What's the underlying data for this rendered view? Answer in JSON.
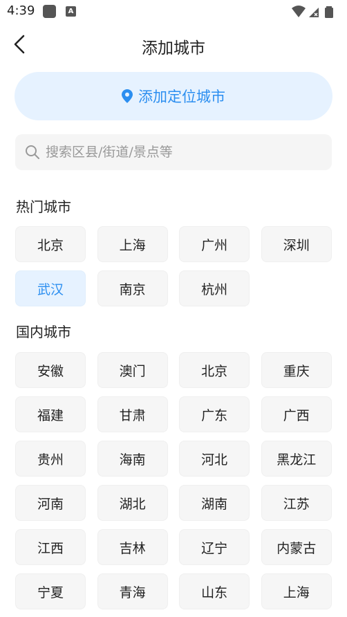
{
  "status": {
    "time": "4:39"
  },
  "header": {
    "title": "添加城市"
  },
  "locate": {
    "label": "添加定位城市"
  },
  "search": {
    "placeholder": "搜索区县/街道/景点等"
  },
  "hot": {
    "title": "热门城市",
    "cities": [
      "北京",
      "上海",
      "广州",
      "深圳",
      "武汉",
      "南京",
      "杭州"
    ],
    "selected": "武汉"
  },
  "domestic": {
    "title": "国内城市",
    "cities": [
      "安徽",
      "澳门",
      "北京",
      "重庆",
      "福建",
      "甘肃",
      "广东",
      "广西",
      "贵州",
      "海南",
      "河北",
      "黑龙江",
      "河南",
      "湖北",
      "湖南",
      "江苏",
      "江西",
      "吉林",
      "辽宁",
      "内蒙古",
      "宁夏",
      "青海",
      "山东",
      "上海"
    ]
  },
  "colors": {
    "accent": "#2b8ef0",
    "accent_bg": "#e6f2ff",
    "chip_bg": "#f6f6f6"
  }
}
